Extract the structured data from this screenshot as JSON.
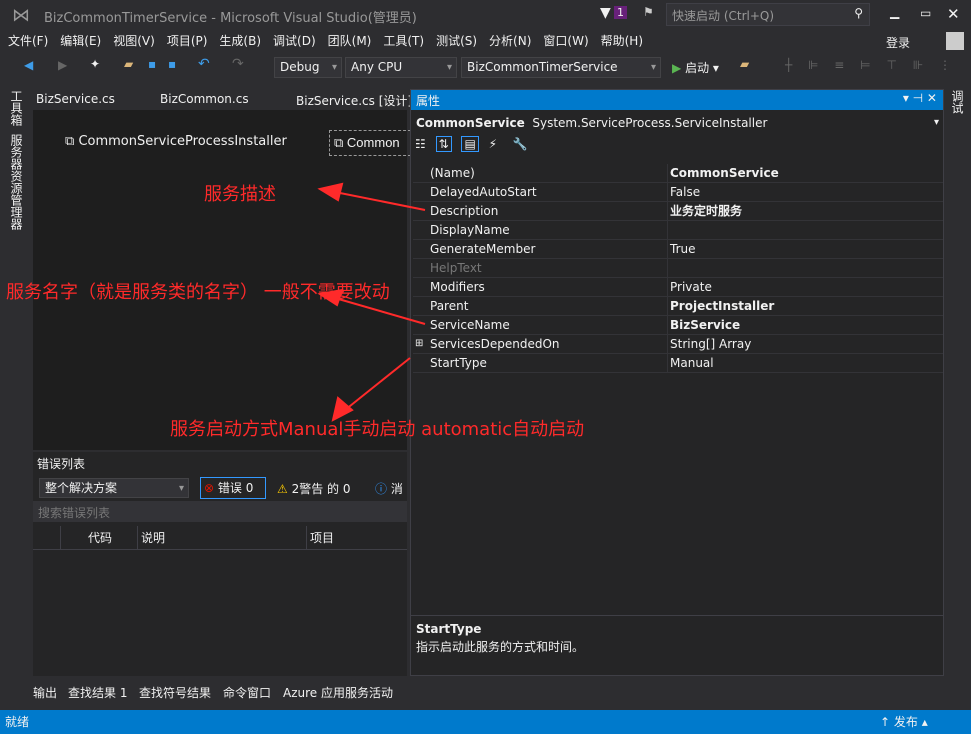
{
  "title": "BizCommonTimerService - Microsoft Visual Studio(管理员)",
  "notification_count": "1",
  "quick_launch_placeholder": "快速启动 (Ctrl+Q)",
  "menu": [
    "文件(F)",
    "编辑(E)",
    "视图(V)",
    "项目(P)",
    "生成(B)",
    "调试(D)",
    "团队(M)",
    "工具(T)",
    "测试(S)",
    "分析(N)",
    "窗口(W)",
    "帮助(H)"
  ],
  "login": "登录",
  "toolbar": {
    "config": "Debug",
    "platform": "Any CPU",
    "project": "BizCommonTimerService",
    "start": "启动"
  },
  "left_strip": [
    "工具箱",
    "服务器资源管理器"
  ],
  "right_strip": "调试",
  "tabs": [
    "BizService.cs",
    "BizCommon.cs",
    "BizService.cs [设计]"
  ],
  "designer": {
    "components": [
      "CommonServiceProcessInstaller",
      "Common"
    ]
  },
  "error_list": {
    "title": "错误列表",
    "scope": "整个解决方案",
    "errors": "错误 0",
    "warnings": "2警告 的 0",
    "messages": "消",
    "search_placeholder": "搜索错误列表",
    "columns": [
      "代码",
      "说明",
      "项目"
    ]
  },
  "properties": {
    "title": "属性",
    "object_name": "CommonService",
    "object_type": "System.ServiceProcess.ServiceInstaller",
    "rows": [
      {
        "name": "(Name)",
        "value": "CommonService",
        "bold": true
      },
      {
        "name": "DelayedAutoStart",
        "value": "False"
      },
      {
        "name": "Description",
        "value": "业务定时服务",
        "bold": true
      },
      {
        "name": "DisplayName",
        "value": ""
      },
      {
        "name": "GenerateMember",
        "value": "True"
      },
      {
        "name": "HelpText",
        "value": "",
        "disabled": true
      },
      {
        "name": "Modifiers",
        "value": "Private"
      },
      {
        "name": "Parent",
        "value": "ProjectInstaller",
        "bold": true
      },
      {
        "name": "ServiceName",
        "value": "BizService",
        "bold": true
      },
      {
        "name": "ServicesDependedOn",
        "value": "String[] Array",
        "expandable": true
      },
      {
        "name": "StartType",
        "value": "Manual"
      }
    ],
    "desc_title": "StartType",
    "desc_text": "指示启动此服务的方式和时间。"
  },
  "annotations": [
    "服务描述",
    "服务名字（就是服务类的名字） 一般不需要改动",
    "服务启动方式Manual手动启动   automatic自动启动"
  ],
  "bottom_tabs": [
    "输出",
    "查找结果 1",
    "查找符号结果",
    "命令窗口",
    "Azure 应用服务活动"
  ],
  "status": {
    "text": "就绪",
    "publish": "发布"
  },
  "colors": {
    "accent": "#007acc",
    "annotation": "#ff2a2a"
  }
}
